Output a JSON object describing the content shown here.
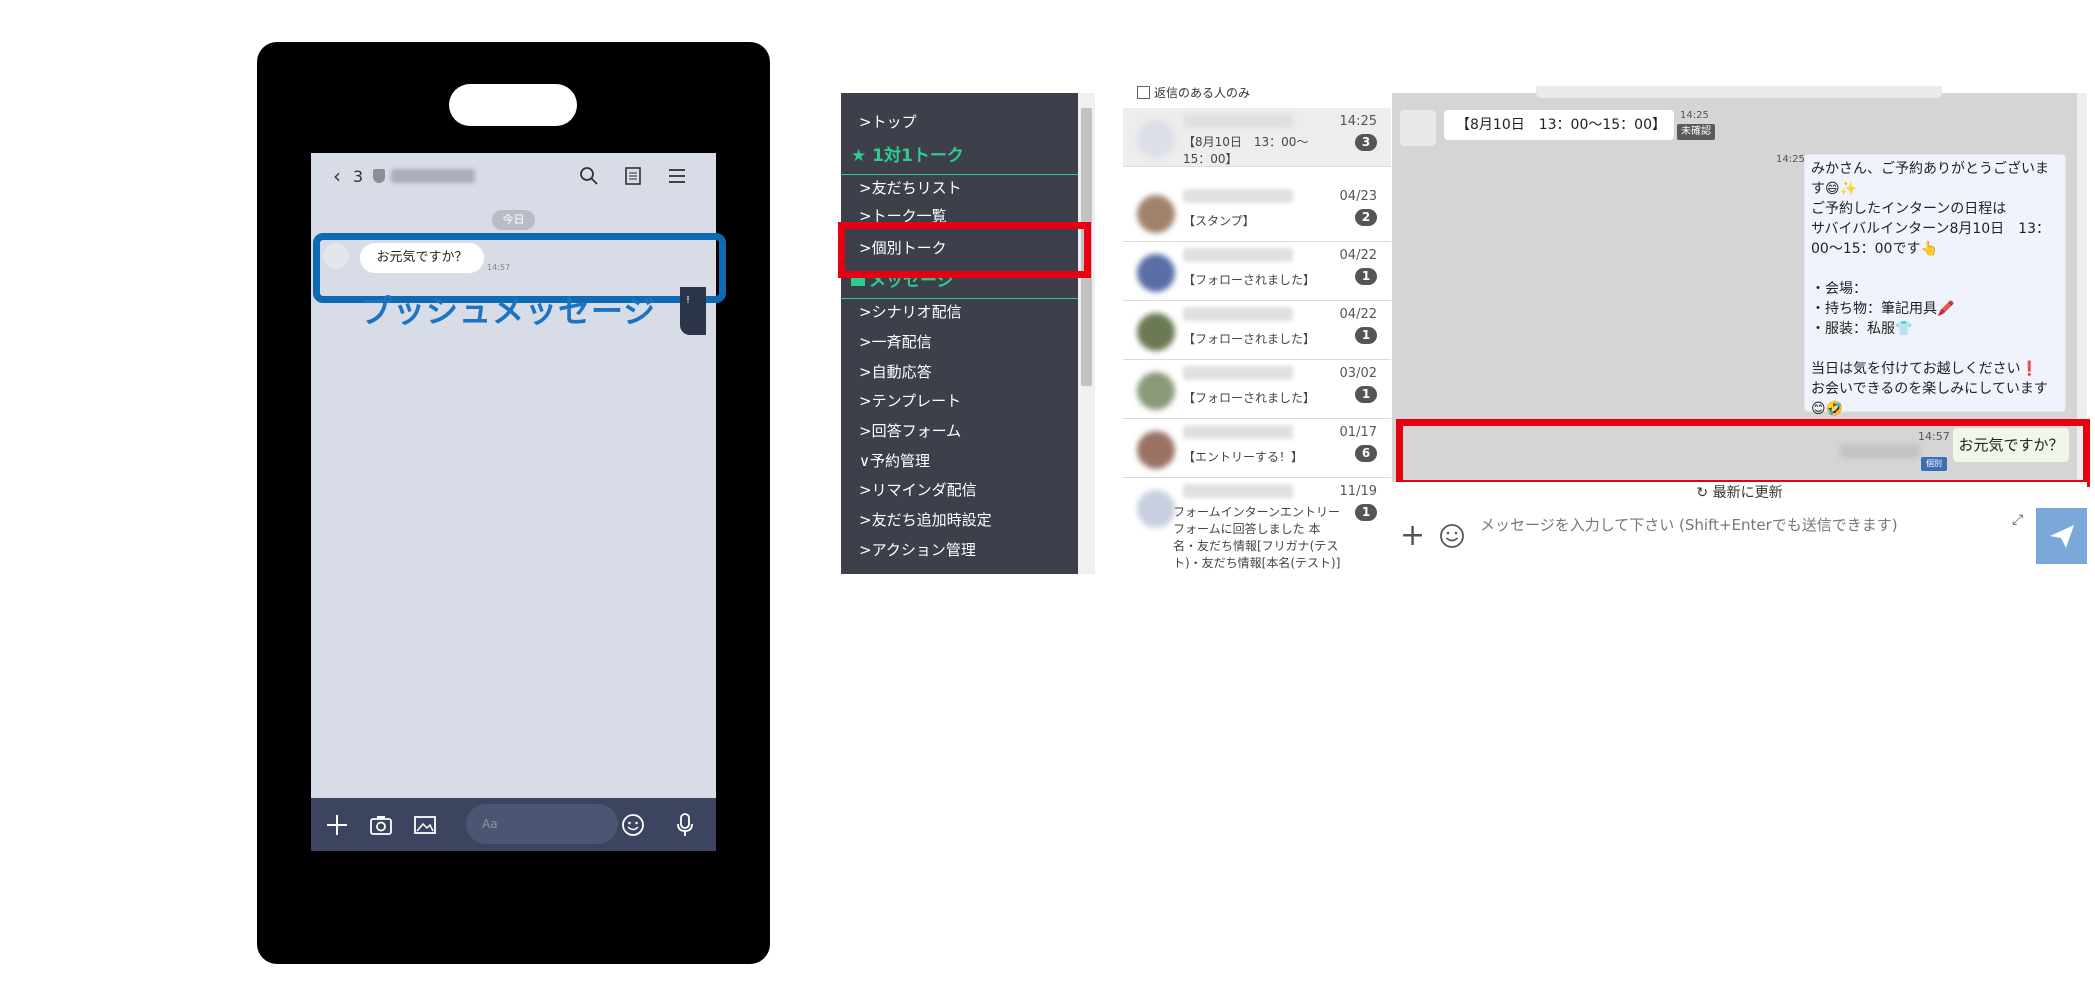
{
  "phone": {
    "back_count": "3",
    "today": "今日",
    "bubble_text": "お元気ですか？",
    "bubble_time": "14:57",
    "push_label": "プッシュメッセージ",
    "input_placeholder": "Aa",
    "side_tab_text": "!"
  },
  "sidebar": {
    "items": [
      {
        "label": "トップ"
      },
      {
        "label": "1対1トーク"
      },
      {
        "label": "友だちリスト"
      },
      {
        "label": "トーク一覧"
      },
      {
        "label": "個別トーク"
      },
      {
        "label": "メッセージ"
      },
      {
        "label": "シナリオ配信"
      },
      {
        "label": "一斉配信"
      },
      {
        "label": "自動応答"
      },
      {
        "label": "テンプレート"
      },
      {
        "label": "回答フォーム"
      },
      {
        "label": "予約管理"
      },
      {
        "label": "リマインダ配信"
      },
      {
        "label": "友だち追加時設定"
      },
      {
        "label": "アクション管理"
      }
    ]
  },
  "list": {
    "filter_label": "返信のある人のみ",
    "rows": [
      {
        "time": "14:25",
        "count": "3",
        "preview": "【8月10日　13：00〜15：00】"
      },
      {
        "time": "04/23",
        "count": "2",
        "preview": "【スタンプ】"
      },
      {
        "time": "04/22",
        "count": "1",
        "preview": "【フォローされました】"
      },
      {
        "time": "04/22",
        "count": "1",
        "preview": "【フォローされました】"
      },
      {
        "time": "03/02",
        "count": "1",
        "preview": "【フォローされました】"
      },
      {
        "time": "01/17",
        "count": "6",
        "preview": "【エントリーする！】"
      },
      {
        "time": "11/19",
        "count": "1",
        "preview": "フォームインターンエントリーフォームに回答しました 本名・友だち情報[フリガナ(テスト)・友だち情報[本名(テスト)]"
      }
    ]
  },
  "chat": {
    "incoming_text": "【8月10日　13：00〜15：00】",
    "incoming_time": "14:25",
    "unread_label": "未確認",
    "outgoing_time": "14:25",
    "outgoing_text": "みかさん、ご予約ありがとうございます😄✨\nご予約したインターンの日程は\nサバイバルインターン8月10日　13：00〜15：00です👆\n\n・会場：\n・持ち物：筆記用具🖍️\n・服装：私服👕\n\n当日は気を付けてお越しください❗\nお会いできるのを楽しみにしています😊🤣",
    "push_text": "お元気ですか？",
    "push_time": "14:57",
    "kobetsu_tag": "個別",
    "update_label": "最新に更新",
    "compose_placeholder": "メッセージを入力して下さい (Shift+Enterでも送信できます)"
  },
  "colors": {
    "highlight_red": "#e60012",
    "highlight_blue": "#0d6ab3",
    "sidebar_bg": "#3d404a",
    "sidebar_accent": "#2ecc8f",
    "send_button": "#7aa9d9"
  }
}
